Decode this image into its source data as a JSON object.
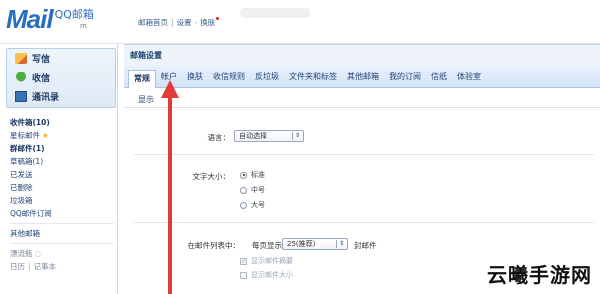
{
  "header": {
    "logo_text": "Mail",
    "logo_cn": "QQ邮箱",
    "account_masked": "m",
    "links": [
      "邮箱首页",
      "设置",
      "换肤"
    ]
  },
  "sidebar": {
    "compose": "写信",
    "inbox": "收信",
    "contacts": "通讯录",
    "folders": [
      {
        "label": "收件箱(10)",
        "style": "bold"
      },
      {
        "label": "星标邮件",
        "style": "star"
      },
      {
        "label": "群邮件(1)",
        "style": "bold"
      },
      {
        "label": "草稿箱(1)",
        "style": "normal"
      },
      {
        "label": "已发送",
        "style": "normal"
      },
      {
        "label": "已删除",
        "style": "normal"
      },
      {
        "label": "垃圾箱",
        "style": "normal"
      },
      {
        "label": "QQ邮件订阅",
        "style": "normal"
      }
    ],
    "other_mailbox": "其他邮箱",
    "extras": [
      "漂流瓶",
      "日历",
      "记事本"
    ]
  },
  "main": {
    "panel_title": "邮箱设置",
    "tabs": [
      "常规",
      "帐户",
      "换肤",
      "收信规则",
      "反垃圾",
      "文件夹和标签",
      "其他邮箱",
      "我的订阅",
      "信纸",
      "体验室"
    ],
    "active_tab": "常规",
    "section_display": "显示",
    "language_label": "语言：",
    "language_value": "自动选择",
    "font_size_label": "文字大小：",
    "font_sizes": [
      "标准",
      "中号",
      "大号"
    ],
    "font_size_selected": "标准",
    "list_label": "在邮件列表中：",
    "per_page_prefix": "每页显示",
    "per_page_value": "25(推荐)",
    "per_page_suffix": "封邮件",
    "options": [
      "显示邮件摘要",
      "显示邮件大小"
    ]
  },
  "watermark": "云曦手游网",
  "colors": {
    "accent": "#2a6fbf",
    "arrow": "#e23b3b"
  }
}
